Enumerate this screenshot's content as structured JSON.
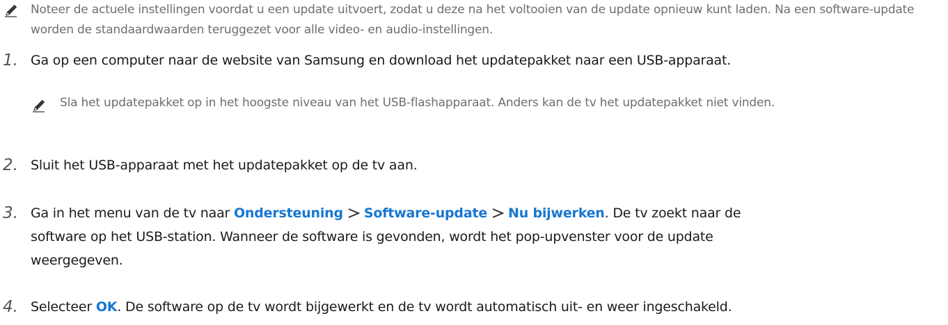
{
  "note_top": {
    "icon": "pencil-icon",
    "text": "Noteer de actuele instellingen voordat u een update uitvoert, zodat u deze na het voltooien van de update opnieuw kunt laden. Na een software-update worden de standaardwaarden teruggezet voor alle video- en audio-instellingen."
  },
  "steps": [
    {
      "number": "1.",
      "text": "Ga op een computer naar de website van Samsung en download het updatepakket naar een USB-apparaat.",
      "note": {
        "icon": "pencil-icon",
        "text": "Sla het updatepakket op in het hoogste niveau van het USB-flashapparaat. Anders kan de tv het updatepakket niet vinden."
      }
    },
    {
      "number": "2.",
      "text": "Sluit het USB-apparaat met het updatepakket op de tv aan."
    },
    {
      "number": "3.",
      "text_before": "Ga in het menu van de tv naar ",
      "path": [
        "Ondersteuning",
        "Software-update",
        "Nu bijwerken"
      ],
      "separator_icon": "chevron-right-icon",
      "text_after": ". De tv zoekt naar de software op het USB-station. Wanneer de software is gevonden, wordt het pop-upvenster voor de update weergegeven."
    },
    {
      "number": "4.",
      "text_before": "Selecteer ",
      "link": "OK",
      "text_after": ". De software op de tv wordt bijgewerkt en de tv wordt automatisch uit- en weer ingeschakeld."
    }
  ],
  "colors": {
    "link": "#1677d2",
    "note_text": "#6e6e6e",
    "body_text": "#1a1a1a"
  }
}
